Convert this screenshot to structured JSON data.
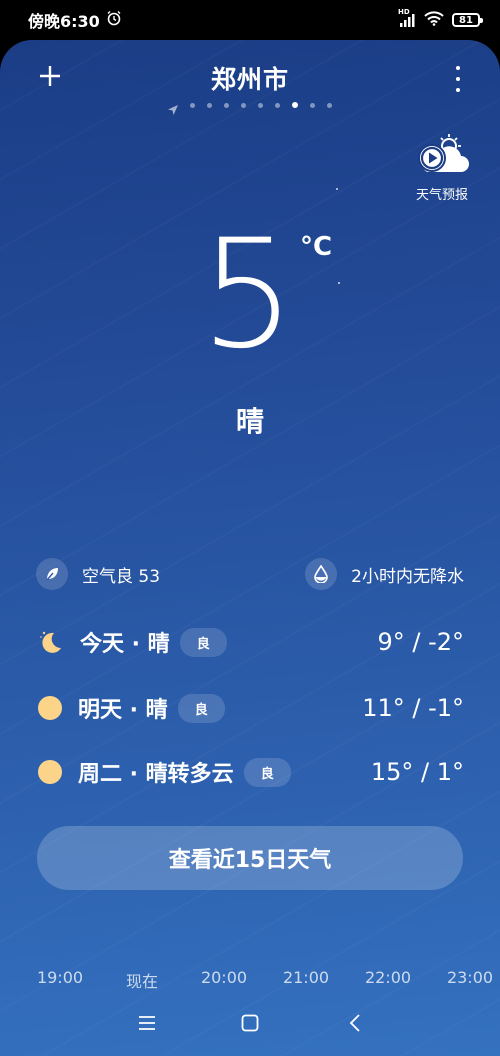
{
  "status_bar": {
    "time": "傍晚6:30",
    "network": "HD",
    "battery": "81"
  },
  "header": {
    "city": "郑州市",
    "page_count": 9,
    "active_page": 7
  },
  "forecast_video": {
    "label": "天气预报"
  },
  "current": {
    "temperature": "5",
    "unit": "°C",
    "condition": "晴"
  },
  "info": {
    "air_quality": "空气良 53",
    "precipitation": "2小时内无降水"
  },
  "days": [
    {
      "label": "今天 · 晴",
      "aqi": "良",
      "temp": "9° / -2°",
      "icon": "moon-icon"
    },
    {
      "label": "明天 · 晴",
      "aqi": "良",
      "temp": "11° / -1°",
      "icon": "sun-icon"
    },
    {
      "label": "周二 · 晴转多云",
      "aqi": "良",
      "temp": "15° / 1°",
      "icon": "sun-icon"
    }
  ],
  "button_15day": "查看近15日天气",
  "hours": [
    "19:00",
    "现在",
    "20:00",
    "21:00",
    "22:00",
    "23:00"
  ],
  "colors": {
    "background_top": "#1b3d86",
    "background_bottom": "#3471bf",
    "sun": "#fcd489"
  }
}
